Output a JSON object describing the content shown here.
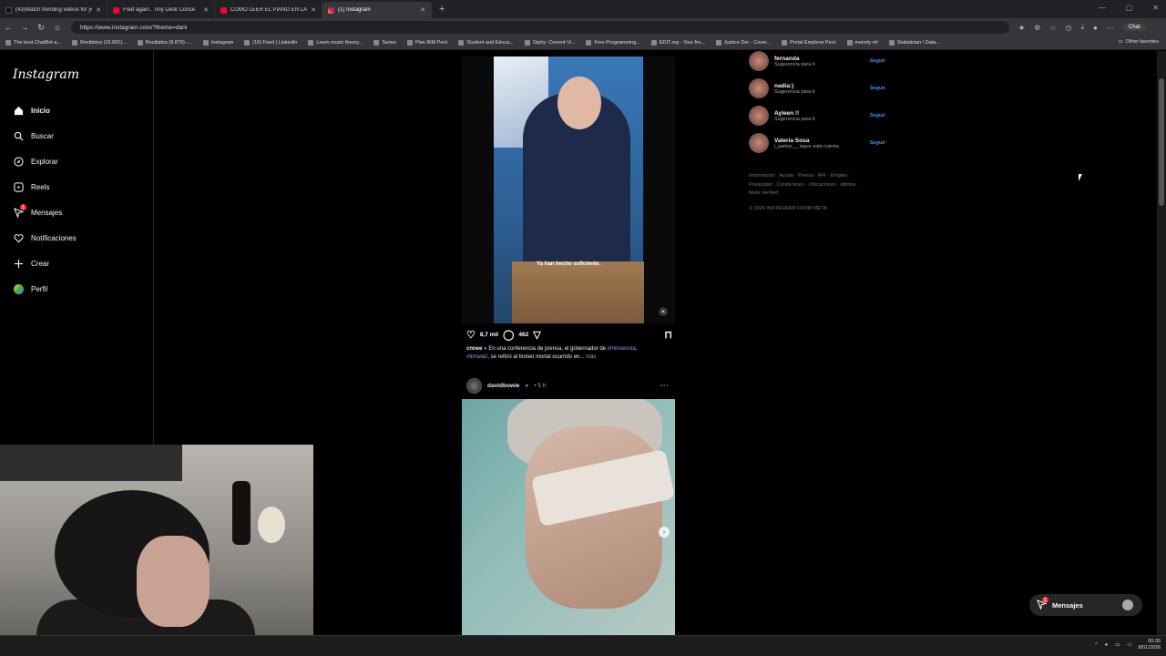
{
  "browser": {
    "tabs": [
      {
        "title": "(43)Watch trending videos for yo",
        "icon": "tiktok-icon"
      },
      {
        "title": "Fred again.. Tiny Desk Conce",
        "icon": "youtube-icon"
      },
      {
        "title": "COMO LEER EL PIANO EN LA GUI",
        "icon": "youtube-icon"
      },
      {
        "title": "(1) Instagram",
        "icon": "instagram-icon",
        "active": true
      }
    ],
    "url": "https://www.instagram.com/?theme=dark",
    "chat_label": "Chat",
    "bookmarks": [
      "The best ChatBot a...",
      "Recibidos (15.891)...",
      "Recibidos (9.879) -...",
      "Instagram",
      "(16) Feed | LinkedIn",
      "Learn music theory...",
      "Series",
      "Plan BIM Perú",
      "Student and Educa...",
      "Giphy: Current Vi...",
      "Free Programming...",
      "EDIT.org - Your fre...",
      "Justice Der - Cover...",
      "Portal Empleos Perú",
      "melody ml",
      "Statistician / Data..."
    ],
    "other_favorites": "Other favorites"
  },
  "sidebar": {
    "logo": "Instagram",
    "items": [
      {
        "label": "Inicio",
        "icon": "home-icon"
      },
      {
        "label": "Buscar",
        "icon": "search-icon"
      },
      {
        "label": "Explorar",
        "icon": "compass-icon"
      },
      {
        "label": "Reels",
        "icon": "reels-icon"
      },
      {
        "label": "Mensajes",
        "icon": "messages-icon",
        "badge": "1"
      },
      {
        "label": "Notificaciones",
        "icon": "heart-icon"
      },
      {
        "label": "Crear",
        "icon": "plus-icon"
      },
      {
        "label": "Perfil",
        "icon": "avatar-icon"
      }
    ]
  },
  "post1": {
    "subtitle": "Ya han hecho suficiente.",
    "likes": "8,7 mil",
    "comments": "462",
    "caption_user": "cnnee",
    "caption_text_1": "En una conferencia de prensa, el gobernador de",
    "hashtag_1": "#minnesota",
    "hashtag_2": "#timwalz",
    "caption_text_2": ", se refirió al tiroteo mortal ocurrido en...",
    "more": "más"
  },
  "post2": {
    "user": "davidbowie",
    "time": "• 5 h"
  },
  "suggestions": [
    {
      "name": "fernanda",
      "sub": "Sugerencia para ti",
      "action": "Seguir"
    },
    {
      "name": "nadia:)",
      "sub": "Sugerencia para ti",
      "action": "Seguir"
    },
    {
      "name": "Ayleen !!",
      "sub": "Sugerencia para ti",
      "action": "Seguir"
    },
    {
      "name": "Valeria Sosa",
      "sub": "j_parker__ sigue esta cuenta",
      "action": "Seguir"
    }
  ],
  "footer": {
    "links_line1": "Información · Ayuda · Prensa · API · Empleo ·",
    "links_line2": "Privacidad · Condiciones · Ubicaciones · Idioma ·",
    "links_line3": "Meta Verified",
    "copyright": "© 2026 INSTAGRAM FROM META"
  },
  "messages_pill": {
    "label": "Mensajes",
    "badge": "1"
  },
  "taskbar": {
    "time": "00:35",
    "date": "8/01/2026"
  },
  "colors": {
    "accent_link": "#4a8ff0",
    "badge": "#ff3040",
    "background": "#000000"
  }
}
